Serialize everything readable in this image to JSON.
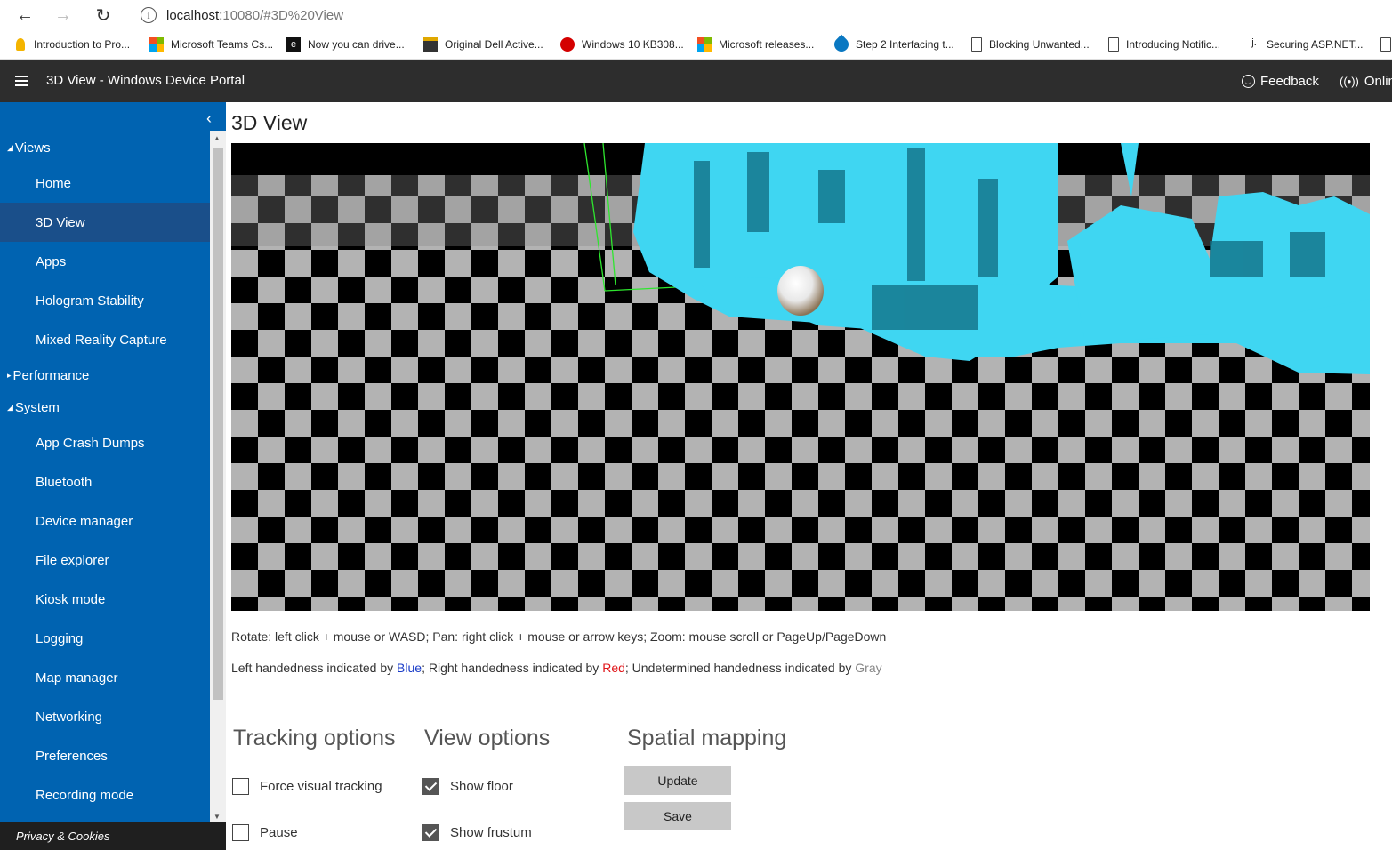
{
  "browser": {
    "url_host": "localhost:",
    "url_rest": "10080/#3D%20View",
    "bookmarks": [
      {
        "label": "Introduction to Pro...",
        "icon": "bookmark-yellow-icon"
      },
      {
        "label": "Microsoft Teams Cs...",
        "icon": "microsoft-logo-icon"
      },
      {
        "label": "Now you can drive...",
        "icon": "engadget-icon"
      },
      {
        "label": "Original Dell Active...",
        "icon": "shop-icon"
      },
      {
        "label": "Windows 10 KB308...",
        "icon": "red-circle-icon"
      },
      {
        "label": "Microsoft releases...",
        "icon": "microsoft-logo-icon"
      },
      {
        "label": "Step 2 Interfacing t...",
        "icon": "drop-icon"
      },
      {
        "label": "Blocking Unwanted...",
        "icon": "page-icon"
      },
      {
        "label": "Introducing Notific...",
        "icon": "page-icon"
      },
      {
        "label": "Securing ASP.NET...",
        "icon": "j-icon"
      }
    ]
  },
  "appbar": {
    "title": "3D View - Windows Device Portal",
    "feedback": "Feedback",
    "online": "Online"
  },
  "sidebar": {
    "groups": {
      "views": "Views",
      "performance": "Performance",
      "system": "System"
    },
    "views_items": [
      "Home",
      "3D View",
      "Apps",
      "Hologram Stability",
      "Mixed Reality Capture"
    ],
    "system_items": [
      "App Crash Dumps",
      "Bluetooth",
      "Device manager",
      "File explorer",
      "Kiosk mode",
      "Logging",
      "Map manager",
      "Networking",
      "Preferences",
      "Recording mode"
    ],
    "active": "3D View",
    "footer": "Privacy & Cookies"
  },
  "main": {
    "title": "3D View",
    "help_controls": "Rotate: left click + mouse or WASD; Pan: right click + mouse or arrow keys; Zoom: mouse scroll or PageUp/PageDown",
    "hand_prefix": "Left handedness indicated by ",
    "hand_blue": "Blue",
    "hand_mid1": "; Right handedness indicated by ",
    "hand_red": "Red",
    "hand_mid2": "; Undetermined handedness indicated by ",
    "hand_gray": "Gray"
  },
  "tracking": {
    "title": "Tracking options",
    "force_visual": {
      "label": "Force visual tracking",
      "checked": false
    },
    "pause": {
      "label": "Pause",
      "checked": false
    }
  },
  "view_options": {
    "title": "View options",
    "show_floor": {
      "label": "Show floor",
      "checked": true
    },
    "show_frustum": {
      "label": "Show frustum",
      "checked": true
    }
  },
  "spatial": {
    "title": "Spatial mapping",
    "update": "Update",
    "save": "Save"
  },
  "colors": {
    "sidebar_bg": "#0063b1",
    "appbar_bg": "#2d2d2d",
    "mesh": "#3fd6f2",
    "floor_light": "#b3b3b3"
  }
}
